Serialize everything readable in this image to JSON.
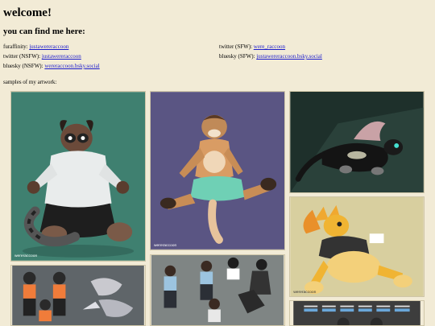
{
  "header": {
    "title": "welcome!",
    "subtitle": "you can find me here:"
  },
  "links": {
    "left": [
      {
        "label": "furaffinity:",
        "link": "justawereraccoon"
      },
      {
        "label": "twitter (NSFW):",
        "link": "justawereraccoon"
      },
      {
        "label": "bluesky (NSFW):",
        "link": "wereraccoon.bsky.social"
      }
    ],
    "right": [
      {
        "label": "twitter (SFW):",
        "link": "were_raccoon"
      },
      {
        "label": "bluesky (SFW):",
        "link": "justawereraccoon.bsky.social"
      }
    ]
  },
  "gallery": {
    "heading": "samples of my artwork:",
    "signature": "wereraccoon",
    "items": [
      {
        "name": "artwork-raccoon-shirt",
        "bg": "#3f8070"
      },
      {
        "name": "artwork-otter-sitting",
        "bg": "#5a5583"
      },
      {
        "name": "artwork-black-dragon",
        "bg": "#1e302b"
      },
      {
        "name": "artwork-yellow-dragon",
        "bg": "#d8cf9f"
      },
      {
        "name": "artwork-sheet-orange",
        "bg": "#5f6569"
      },
      {
        "name": "artwork-sheet-characters",
        "bg": "#7f8584"
      },
      {
        "name": "artwork-reference-sheet",
        "bg": "#3d3d3d"
      }
    ]
  },
  "colors": {
    "background": "#f2ebd6",
    "link": "#1a1acc"
  }
}
